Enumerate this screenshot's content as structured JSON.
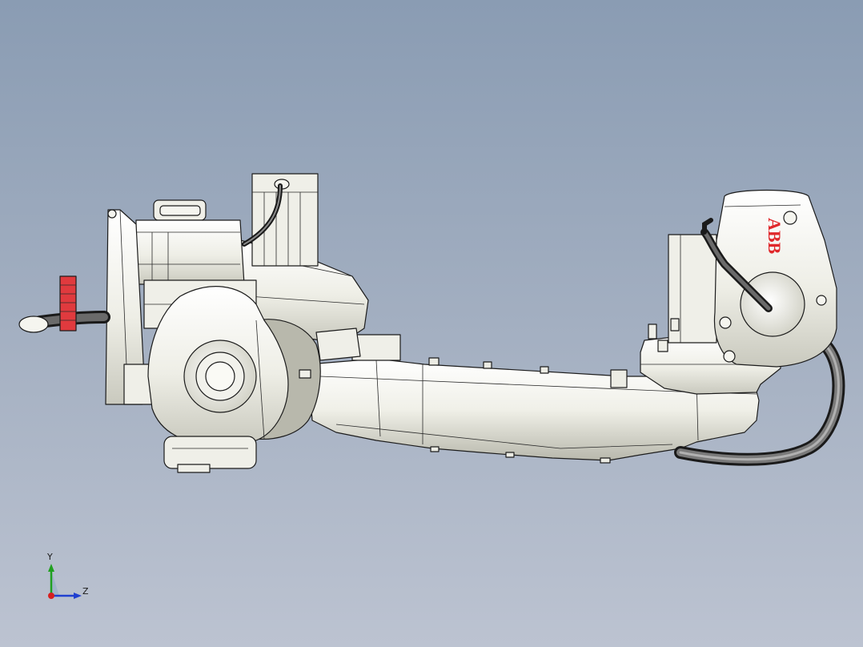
{
  "model": {
    "name": "robot-arm-assembly",
    "logo_text": "ABB",
    "colors": {
      "background_top": "#8a9cb3",
      "background_bottom": "#bcc3d1",
      "body": "#f2f2ec",
      "shade": "#d9d9d0",
      "cable": "#4a4a4a",
      "logo": "#e0282b",
      "grip": "#e03a3e"
    }
  },
  "triad": {
    "y_label": "Y",
    "z_label": "Z",
    "x_color": "#d62020",
    "y_color": "#20a020",
    "z_color": "#2040d0"
  }
}
